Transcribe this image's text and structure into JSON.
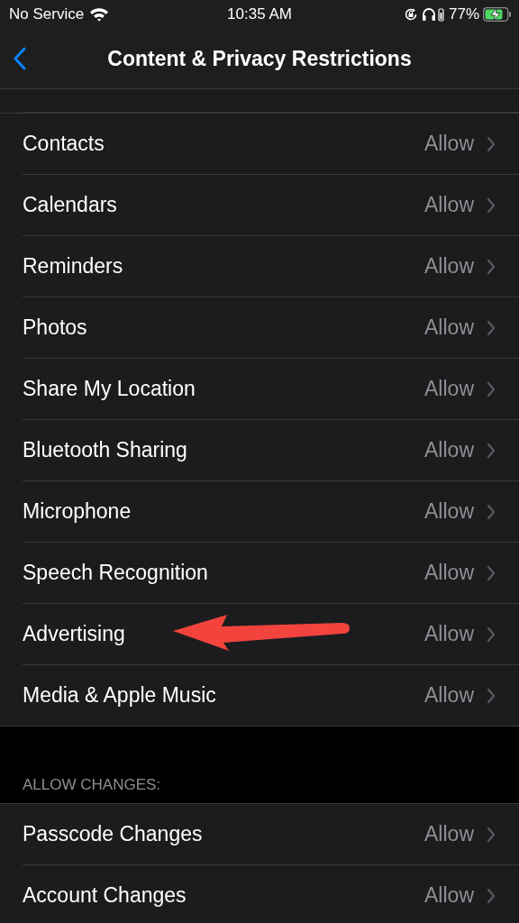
{
  "status_bar": {
    "carrier": "No Service",
    "time": "10:35 AM",
    "battery": "77%"
  },
  "nav": {
    "title": "Content & Privacy Restrictions"
  },
  "sections": [
    {
      "rows": [
        {
          "label": "Contacts",
          "value": "Allow",
          "arrow_pointer": false
        },
        {
          "label": "Calendars",
          "value": "Allow",
          "arrow_pointer": false
        },
        {
          "label": "Reminders",
          "value": "Allow",
          "arrow_pointer": false
        },
        {
          "label": "Photos",
          "value": "Allow",
          "arrow_pointer": false
        },
        {
          "label": "Share My Location",
          "value": "Allow",
          "arrow_pointer": false
        },
        {
          "label": "Bluetooth Sharing",
          "value": "Allow",
          "arrow_pointer": false
        },
        {
          "label": "Microphone",
          "value": "Allow",
          "arrow_pointer": false
        },
        {
          "label": "Speech Recognition",
          "value": "Allow",
          "arrow_pointer": false
        },
        {
          "label": "Advertising",
          "value": "Allow",
          "arrow_pointer": true
        },
        {
          "label": "Media & Apple Music",
          "value": "Allow",
          "arrow_pointer": false
        }
      ]
    },
    {
      "header": "ALLOW CHANGES:",
      "rows": [
        {
          "label": "Passcode Changes",
          "value": "Allow",
          "arrow_pointer": false
        },
        {
          "label": "Account Changes",
          "value": "Allow",
          "arrow_pointer": false
        }
      ]
    }
  ]
}
